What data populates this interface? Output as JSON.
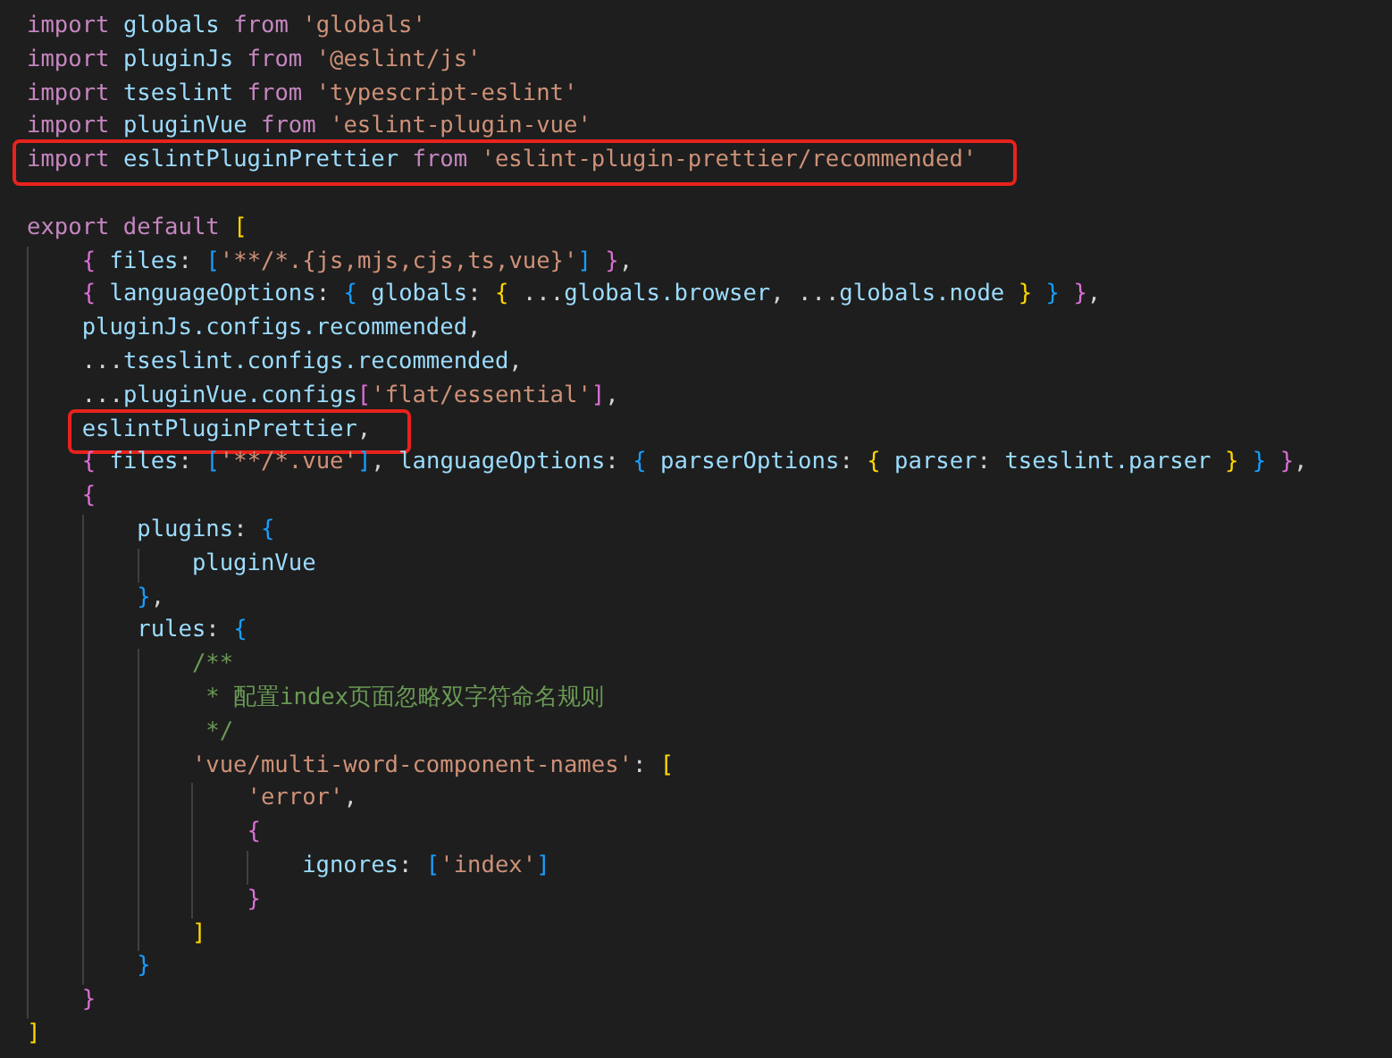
{
  "editor": {
    "lines": [
      {
        "kind": "code",
        "tokens": [
          {
            "text": "import ",
            "kind": "keyword"
          },
          {
            "text": "globals ",
            "kind": "variable"
          },
          {
            "text": "from ",
            "kind": "keyword"
          },
          {
            "text": "'globals'",
            "kind": "string"
          }
        ]
      },
      {
        "kind": "code",
        "tokens": [
          {
            "text": "import ",
            "kind": "keyword"
          },
          {
            "text": "pluginJs ",
            "kind": "variable"
          },
          {
            "text": "from ",
            "kind": "keyword"
          },
          {
            "text": "'@eslint/js'",
            "kind": "string"
          }
        ]
      },
      {
        "kind": "code",
        "tokens": [
          {
            "text": "import ",
            "kind": "keyword"
          },
          {
            "text": "tseslint ",
            "kind": "variable"
          },
          {
            "text": "from ",
            "kind": "keyword"
          },
          {
            "text": "'typescript-eslint'",
            "kind": "string"
          }
        ]
      },
      {
        "kind": "code",
        "tokens": [
          {
            "text": "import ",
            "kind": "keyword"
          },
          {
            "text": "pluginVue ",
            "kind": "variable"
          },
          {
            "text": "from ",
            "kind": "keyword"
          },
          {
            "text": "'eslint-plugin-vue'",
            "kind": "string"
          }
        ]
      },
      {
        "kind": "code",
        "boxed": true,
        "tokens": [
          {
            "text": "import ",
            "kind": "keyword"
          },
          {
            "text": "eslintPluginPrettier ",
            "kind": "variable"
          },
          {
            "text": "from ",
            "kind": "keyword"
          },
          {
            "text": "'eslint-plugin-prettier/recommended'",
            "kind": "string"
          }
        ]
      },
      {
        "kind": "blank"
      },
      {
        "kind": "code",
        "tokens": [
          {
            "text": "export default ",
            "kind": "keyword"
          },
          {
            "text": "[",
            "kind": "bracket1"
          }
        ],
        "children": [
          {
            "kind": "code",
            "tokens": [
              {
                "text": "{ ",
                "kind": "bracket2"
              },
              {
                "text": "files",
                "kind": "variable"
              },
              {
                "text": ": ",
                "kind": "punct"
              },
              {
                "text": "[",
                "kind": "bracket3"
              },
              {
                "text": "'**/*.{js,mjs,cjs,ts,vue}'",
                "kind": "string"
              },
              {
                "text": "] ",
                "kind": "bracket3"
              },
              {
                "text": "}",
                "kind": "bracket2"
              },
              {
                "text": ",",
                "kind": "punct"
              }
            ]
          },
          {
            "kind": "code",
            "tokens": [
              {
                "text": "{ ",
                "kind": "bracket2"
              },
              {
                "text": "languageOptions",
                "kind": "variable"
              },
              {
                "text": ": ",
                "kind": "punct"
              },
              {
                "text": "{ ",
                "kind": "bracket3"
              },
              {
                "text": "globals",
                "kind": "variable"
              },
              {
                "text": ": ",
                "kind": "punct"
              },
              {
                "text": "{ ",
                "kind": "bracket1"
              },
              {
                "text": "...",
                "kind": "punct"
              },
              {
                "text": "globals.browser",
                "kind": "variable"
              },
              {
                "text": ", ...",
                "kind": "punct"
              },
              {
                "text": "globals.node ",
                "kind": "variable"
              },
              {
                "text": "} ",
                "kind": "bracket1"
              },
              {
                "text": "} ",
                "kind": "bracket3"
              },
              {
                "text": "}",
                "kind": "bracket2"
              },
              {
                "text": ",",
                "kind": "punct"
              }
            ]
          },
          {
            "kind": "code",
            "tokens": [
              {
                "text": "pluginJs.configs.recommended",
                "kind": "variable"
              },
              {
                "text": ",",
                "kind": "punct"
              }
            ]
          },
          {
            "kind": "code",
            "tokens": [
              {
                "text": "...",
                "kind": "punct"
              },
              {
                "text": "tseslint.configs.recommended",
                "kind": "variable"
              },
              {
                "text": ",",
                "kind": "punct"
              }
            ]
          },
          {
            "kind": "code",
            "tokens": [
              {
                "text": "...",
                "kind": "punct"
              },
              {
                "text": "pluginVue.configs",
                "kind": "variable"
              },
              {
                "text": "[",
                "kind": "bracket2"
              },
              {
                "text": "'flat/essential'",
                "kind": "string"
              },
              {
                "text": "]",
                "kind": "bracket2"
              },
              {
                "text": ",",
                "kind": "punct"
              }
            ]
          },
          {
            "kind": "code",
            "boxed": true,
            "tokens": [
              {
                "text": "eslintPluginPrettier",
                "kind": "variable"
              },
              {
                "text": ",",
                "kind": "punct"
              }
            ]
          },
          {
            "kind": "code",
            "tokens": [
              {
                "text": "{ ",
                "kind": "bracket2"
              },
              {
                "text": "files",
                "kind": "variable"
              },
              {
                "text": ": ",
                "kind": "punct"
              },
              {
                "text": "[",
                "kind": "bracket3"
              },
              {
                "text": "'**/*.vue'",
                "kind": "string"
              },
              {
                "text": "]",
                "kind": "bracket3"
              },
              {
                "text": ", ",
                "kind": "punct"
              },
              {
                "text": "languageOptions",
                "kind": "variable"
              },
              {
                "text": ": ",
                "kind": "punct"
              },
              {
                "text": "{ ",
                "kind": "bracket3"
              },
              {
                "text": "parserOptions",
                "kind": "variable"
              },
              {
                "text": ": ",
                "kind": "punct"
              },
              {
                "text": "{ ",
                "kind": "bracket1"
              },
              {
                "text": "parser",
                "kind": "variable"
              },
              {
                "text": ": ",
                "kind": "punct"
              },
              {
                "text": "tseslint.parser ",
                "kind": "variable"
              },
              {
                "text": "} ",
                "kind": "bracket1"
              },
              {
                "text": "} ",
                "kind": "bracket3"
              },
              {
                "text": "}",
                "kind": "bracket2"
              },
              {
                "text": ",",
                "kind": "punct"
              }
            ]
          },
          {
            "kind": "code",
            "tokens": [
              {
                "text": "{",
                "kind": "bracket2"
              }
            ],
            "children": [
              {
                "kind": "code",
                "tokens": [
                  {
                    "text": "plugins",
                    "kind": "variable"
                  },
                  {
                    "text": ": ",
                    "kind": "punct"
                  },
                  {
                    "text": "{",
                    "kind": "bracket3"
                  }
                ],
                "children": [
                  {
                    "kind": "code",
                    "tokens": [
                      {
                        "text": "pluginVue",
                        "kind": "variable"
                      }
                    ]
                  }
                ]
              },
              {
                "kind": "code",
                "tokens": [
                  {
                    "text": "}",
                    "kind": "bracket3"
                  },
                  {
                    "text": ",",
                    "kind": "punct"
                  }
                ]
              },
              {
                "kind": "code",
                "tokens": [
                  {
                    "text": "rules",
                    "kind": "variable"
                  },
                  {
                    "text": ": ",
                    "kind": "punct"
                  },
                  {
                    "text": "{",
                    "kind": "bracket3"
                  }
                ],
                "children": [
                  {
                    "kind": "code",
                    "tokens": [
                      {
                        "text": "/**",
                        "kind": "comment"
                      }
                    ]
                  },
                  {
                    "kind": "code",
                    "tokens": [
                      {
                        "text": " * 配置index页面忽略双字符命名规则",
                        "kind": "comment"
                      }
                    ]
                  },
                  {
                    "kind": "code",
                    "tokens": [
                      {
                        "text": " */",
                        "kind": "comment"
                      }
                    ]
                  },
                  {
                    "kind": "code",
                    "tokens": [
                      {
                        "text": "'vue/multi-word-component-names'",
                        "kind": "string"
                      },
                      {
                        "text": ": ",
                        "kind": "punct"
                      },
                      {
                        "text": "[",
                        "kind": "bracket1"
                      }
                    ],
                    "children": [
                      {
                        "kind": "code",
                        "tokens": [
                          {
                            "text": "'error'",
                            "kind": "string"
                          },
                          {
                            "text": ",",
                            "kind": "punct"
                          }
                        ]
                      },
                      {
                        "kind": "code",
                        "tokens": [
                          {
                            "text": "{",
                            "kind": "bracket2"
                          }
                        ],
                        "children": [
                          {
                            "kind": "code",
                            "tokens": [
                              {
                                "text": "ignores",
                                "kind": "variable"
                              },
                              {
                                "text": ": ",
                                "kind": "punct"
                              },
                              {
                                "text": "[",
                                "kind": "bracket3"
                              },
                              {
                                "text": "'index'",
                                "kind": "string"
                              },
                              {
                                "text": "]",
                                "kind": "bracket3"
                              }
                            ]
                          }
                        ]
                      },
                      {
                        "kind": "code",
                        "tokens": [
                          {
                            "text": "}",
                            "kind": "bracket2"
                          }
                        ]
                      }
                    ]
                  },
                  {
                    "kind": "code",
                    "tokens": [
                      {
                        "text": "]",
                        "kind": "bracket1"
                      }
                    ]
                  }
                ]
              },
              {
                "kind": "code",
                "tokens": [
                  {
                    "text": "}",
                    "kind": "bracket3"
                  }
                ]
              }
            ]
          },
          {
            "kind": "code",
            "tokens": [
              {
                "text": "}",
                "kind": "bracket2"
              }
            ]
          }
        ]
      },
      {
        "kind": "code",
        "tokens": [
          {
            "text": "]",
            "kind": "bracket1"
          }
        ]
      }
    ]
  }
}
